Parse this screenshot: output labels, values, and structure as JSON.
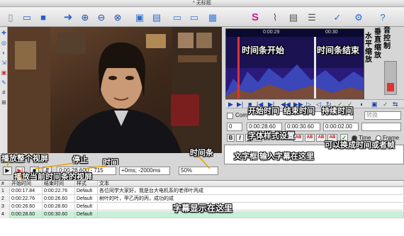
{
  "window": {
    "title": "* 无标题"
  },
  "toolbar": {
    "icons": [
      "new-file-icon",
      "open-folder-icon",
      "save-icon",
      "arrow-right-icon",
      "zoom-in-icon",
      "zoom-out-icon",
      "zoom-fit-icon",
      "video-frame-icon",
      "waveform-icon",
      "monitor-left-icon",
      "monitor-right-icon",
      "film-icon",
      "subtitle-s-icon",
      "paperclip-icon",
      "document-icon",
      "list-icon",
      "spell-icon",
      "settings-icon",
      "help-icon"
    ]
  },
  "waveform": {
    "ruler_left": "0:00:29",
    "ruler_right": "00:30",
    "label_start": "时间条开始",
    "label_end": "时间条结束"
  },
  "vertical_labels": {
    "horizontal_zoom": "水平缩放",
    "vertical_zoom": "垂直缩放",
    "playback_control": "音控制"
  },
  "edit": {
    "comment_label": "Com",
    "layer_value": "0",
    "start_time": "0:00:28.60",
    "end_time": "0:00:30.60",
    "duration": "0:00:02.00",
    "style_placeholder": "转换",
    "time_option": "Time",
    "frame_option": "Frame",
    "bold": "B",
    "italic": "I",
    "underline": "U",
    "strike": "S",
    "ab1": "AB",
    "ab2": "AB",
    "ab3": "AB",
    "ab4": "AB"
  },
  "annotations": {
    "start_time": "开始时间",
    "end_time": "结束时间",
    "duration": "持续时间",
    "font_style": "字体样式设置",
    "time_or_frame": "可以换成时间或者帧",
    "text_box": "文字框 输入字幕在这里",
    "time_bar": "时间条",
    "play_all": "播放整个视屏",
    "stop": "停止",
    "time": "时间",
    "play_current": "播放当前时间条的视屏",
    "subtitle_display": "字幕显示在这里"
  },
  "playbar": {
    "time_display": "0:00:28.600 - 715",
    "offset_display": "+0ms; -2000ms",
    "zoom_select": "50%"
  },
  "grid": {
    "headers": [
      "#",
      "开始时间",
      "结束时间",
      "样式",
      "文本"
    ],
    "rows": [
      {
        "num": "1",
        "start": "0:00:17.84",
        "end": "0:00:22.76",
        "style": "Default",
        "text": "各位同学大家好，我是台大电机系的老师叶丙成"
      },
      {
        "num": "2",
        "start": "0:00:22.76",
        "end": "0:00:26.60",
        "style": "Default",
        "text": "树叶的叶，甲乙丙的丙，成功的成"
      },
      {
        "num": "3",
        "start": "0:00:26.60",
        "end": "0:00:28.60",
        "style": "Default",
        "text": ""
      },
      {
        "num": "4",
        "start": "0:00:28.60",
        "end": "0:00:30.60",
        "style": "Default",
        "text": ""
      }
    ]
  }
}
